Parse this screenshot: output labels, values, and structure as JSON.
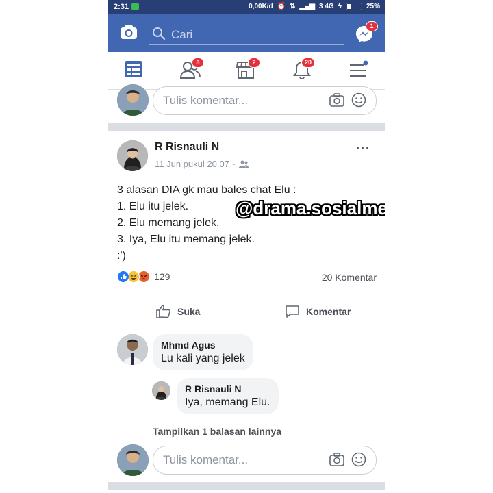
{
  "status_bar": {
    "time": "2:31",
    "network_speed": "0,00K/d",
    "carrier": "3 4G",
    "battery": "25%",
    "battery_level": 0.25
  },
  "top_bar": {
    "camera_icon": "camera-icon",
    "search_placeholder": "Cari",
    "messenger_badge": "1"
  },
  "nav": {
    "feed_icon": "news-feed-icon",
    "friends_badge": "8",
    "marketplace_badge": "2",
    "notifications_badge": "20",
    "menu_icon": "menu-icon"
  },
  "comment_box_top": {
    "placeholder": "Tulis komentar..."
  },
  "post": {
    "author": "R Risnauli N",
    "date": "11 Jun pukul 20.07",
    "privacy_separator": "·",
    "lines": [
      "3 alasan DIA gk mau bales chat Elu :",
      "1. Elu itu jelek.",
      "2. Elu memang jelek.",
      "3. Iya, Elu itu memang jelek.",
      ":')"
    ],
    "watermark": "@drama.sosialmedia",
    "reaction_count": "129",
    "comment_count": "20 Komentar",
    "like_label": "Suka",
    "comment_label": "Komentar"
  },
  "comments": [
    {
      "name": "Mhmd Agus",
      "text": "Lu kali yang jelek"
    }
  ],
  "replies": [
    {
      "name": "R Risnauli N",
      "text": "Iya, memang Elu."
    }
  ],
  "more_replies": "Tampilkan 1 balasan lainnya",
  "comment_box_bottom": {
    "placeholder": "Tulis komentar..."
  },
  "colors": {
    "facebook_blue": "#4267b2",
    "status_bar": "#273f74",
    "badge_red": "#e4313a"
  }
}
